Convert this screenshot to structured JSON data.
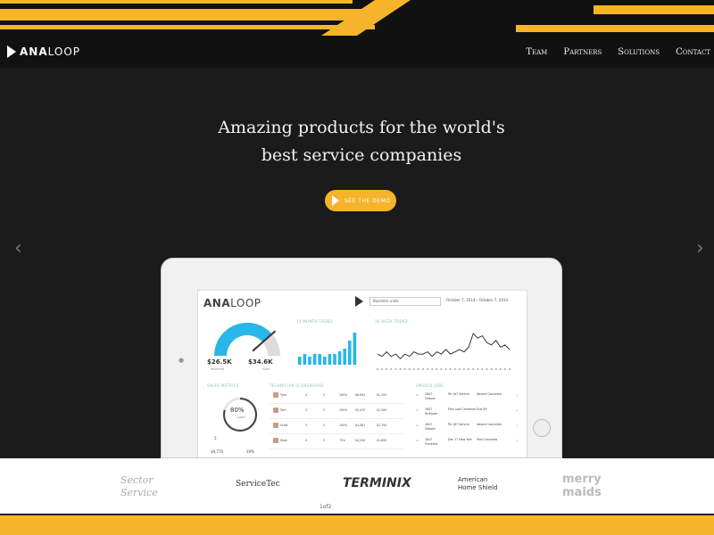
{
  "colors": {
    "accent": "#f5b42a",
    "background": "#1b1b1b",
    "nav": "#111111",
    "gauge": "#29b6e8"
  },
  "brand": {
    "name_bold": "ANA",
    "name_light": "LOOP"
  },
  "nav": {
    "items": [
      "Team",
      "Partners",
      "Solutions",
      "Contact"
    ]
  },
  "hero": {
    "headline_line1": "Amazing products for the world's",
    "headline_line2": "best service companies",
    "cta_label": "SEE THE DEMO",
    "prev_arrow": "‹",
    "next_arrow": "›"
  },
  "dashboard": {
    "logo_bold": "ANA",
    "logo_light": "LOOP",
    "select_value": "Business units",
    "date_range": "October 7, 2014 - October 7, 2014",
    "gauge": {
      "left_value": "$26.5K",
      "left_label": "Revenue",
      "right_value": "$34.6K",
      "right_label": "Goal",
      "fill_fraction": 0.77
    },
    "bar_title": "12 MONTH TREND",
    "bar_values": [
      3,
      4,
      3,
      4,
      4,
      3,
      4,
      4,
      5,
      6,
      9,
      12
    ],
    "line_title": "30 WEEK TREND",
    "line_values": [
      5,
      4,
      6,
      4,
      5,
      3,
      5,
      4,
      6,
      5,
      5,
      6,
      4,
      6,
      5,
      7,
      5,
      6,
      7,
      6,
      8,
      14,
      12,
      13,
      10,
      9,
      11,
      8,
      9,
      7
    ],
    "sales_title": "SALES METRICS",
    "ring_value": "80%",
    "ring_label": "Close",
    "stat1": "5",
    "stat2": "$9,770",
    "stat3": "29%",
    "tech_title": "TECHNICIAN SCOREBOARD",
    "tech_rows": [
      {
        "name": "Tyler",
        "a": "4",
        "b": "3",
        "c": "100%",
        "d": "$6,094",
        "e": "$1,250"
      },
      {
        "name": "Tom",
        "a": "3",
        "b": "3",
        "c": "100%",
        "d": "$5,470",
        "e": "$1,500"
      },
      {
        "name": "Scott",
        "a": "3",
        "b": "2",
        "c": "100%",
        "d": "$4,981",
        "e": "$1,750"
      },
      {
        "name": "Mark",
        "a": "4",
        "b": "3",
        "c": "75%",
        "d": "$4,250",
        "e": "$1,650"
      }
    ],
    "jobs_title": "UNSOLD JOBS",
    "jobs": [
      {
        "id": "1847",
        "city": "Ottawa",
        "desc": "Pb 167 Service",
        "status": "Absent Cancelled"
      },
      {
        "id": "1847",
        "city": "Yorktown",
        "desc": "Plan Lost Cancelled",
        "status": "Due $9"
      },
      {
        "id": "1847",
        "city": "Ottawa",
        "desc": "Pb 167 Service",
        "status": "Absent Cancelled"
      },
      {
        "id": "1847",
        "city": "Frankfort",
        "desc": "Dec 17 New York",
        "status": "Paid Cancelled"
      }
    ]
  },
  "clients": {
    "logos": [
      "Sector Service",
      "ServiceTec",
      "TERMINIX",
      "American Home Shield",
      "merry maids"
    ],
    "pager": "1of2"
  }
}
